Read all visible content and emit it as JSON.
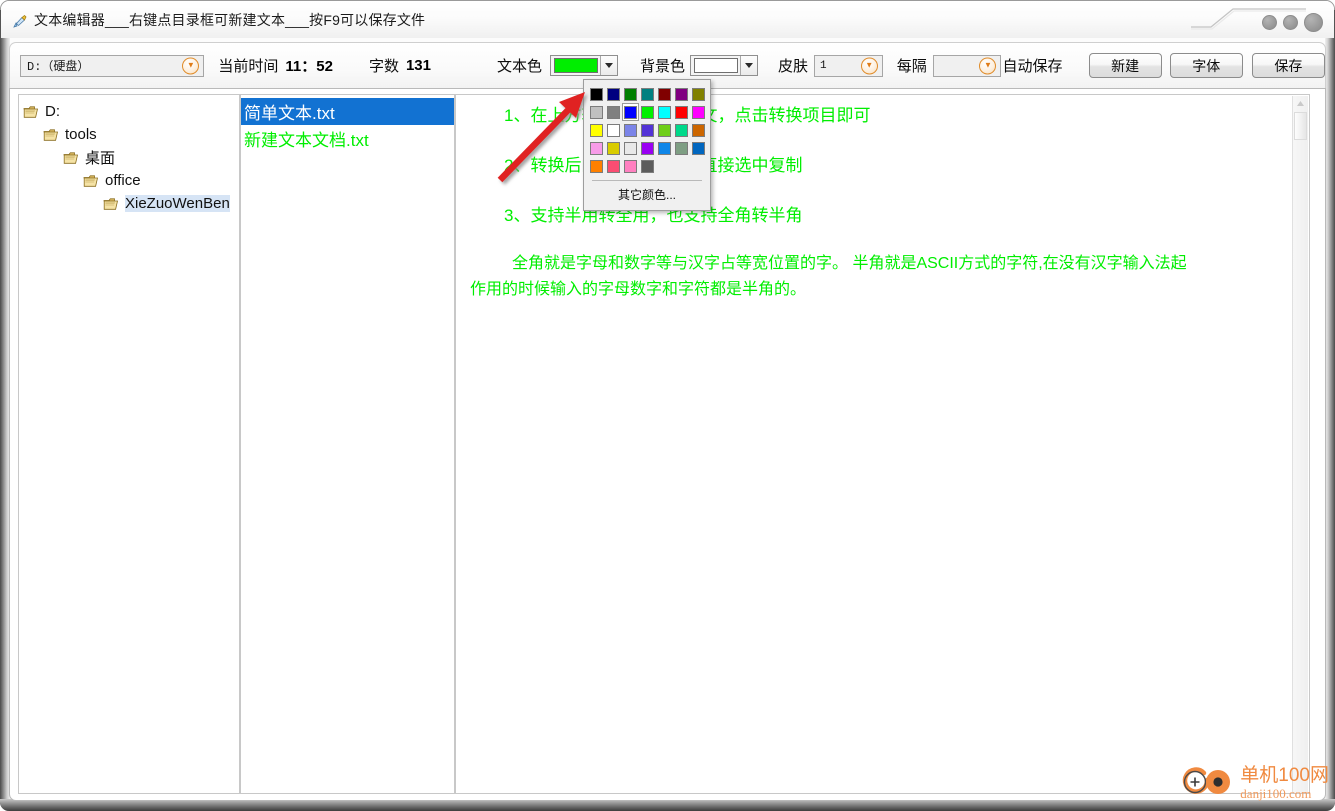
{
  "window": {
    "title": "文本编辑器___右键点目录框可新建文本___按F9可以保存文件",
    "icon": "brush-icon",
    "controls": {
      "minimize": "minimize-button",
      "maximize": "maximize-button",
      "close": "close-button"
    }
  },
  "toolbar": {
    "drive_select": {
      "value": "D:（硬盘）",
      "chevron": "chevron-down-icon"
    },
    "time_label": "当前时间",
    "time_value": "11：52",
    "wordcount_label": "字数",
    "wordcount_value": "131",
    "textcolor_label": "文本色",
    "textcolor_value": "#00EE00",
    "bgcolor_label": "背景色",
    "bgcolor_value": "#FFFFFF",
    "skin_label": "皮肤",
    "skin_value": "1",
    "interval_label": "每隔",
    "interval_value": "",
    "autosave_label": "自动保存",
    "new_button": "新建",
    "font_button": "字体",
    "save_button": "保存"
  },
  "palette": {
    "more_label": "其它颜色...",
    "selected_index": 9,
    "rows": [
      [
        "#000000",
        "#000080",
        "#007F00",
        "#008080",
        "#800000",
        "#800080",
        "#808000"
      ],
      [
        "#C0C0C0",
        "#808080",
        "#0000FF",
        "#00F000",
        "#00FFFF",
        "#FF0000",
        "#FF00FF"
      ],
      [
        "#FFFF00",
        "#FFFFFF",
        "#7B84E8",
        "#5333D6",
        "#6FCE18",
        "#00D98A",
        "#CC6600"
      ],
      [
        "#F79BE8",
        "#D9CC00",
        "#E8E8E8",
        "#9900F2",
        "#0F86E8",
        "#7E9E83",
        "#0066BF"
      ],
      [
        "#FF8000",
        "#FA4D72",
        "#FF80C0",
        "#5C5C5C"
      ]
    ]
  },
  "tree": {
    "items": [
      {
        "label": "D:",
        "depth": 0,
        "icon": "folder-icon"
      },
      {
        "label": "tools",
        "depth": 1,
        "icon": "folder-icon"
      },
      {
        "label": "桌面",
        "depth": 2,
        "icon": "folder-icon"
      },
      {
        "label": "office",
        "depth": 3,
        "icon": "folder-icon"
      },
      {
        "label": "XieZuoWenBen",
        "depth": 4,
        "icon": "folder-icon",
        "selected": true
      }
    ]
  },
  "files": {
    "items": [
      {
        "name": "简单文本.txt",
        "selected": true
      },
      {
        "name": "新建文本文档.txt",
        "selected": false
      }
    ]
  },
  "editor": {
    "lines": [
      "1、在上方输入要转换的中文，点击转换项目即可",
      "2、转换后的内容在下方，直接选中复制",
      "3、支持半用转全用，也支持全角转半角"
    ],
    "paragraph_1": "全角就是字母和数字等与汉字占等宽位置的字。 半角就是ASCII方式的字符,在没有汉字输入法起",
    "paragraph_2": "作用的时候输入的字母数字和字符都是半角的。",
    "text_color": "#00EE00"
  },
  "watermark": {
    "main": "单机100网",
    "sub": "danji100.com",
    "color": "#F08A40"
  }
}
